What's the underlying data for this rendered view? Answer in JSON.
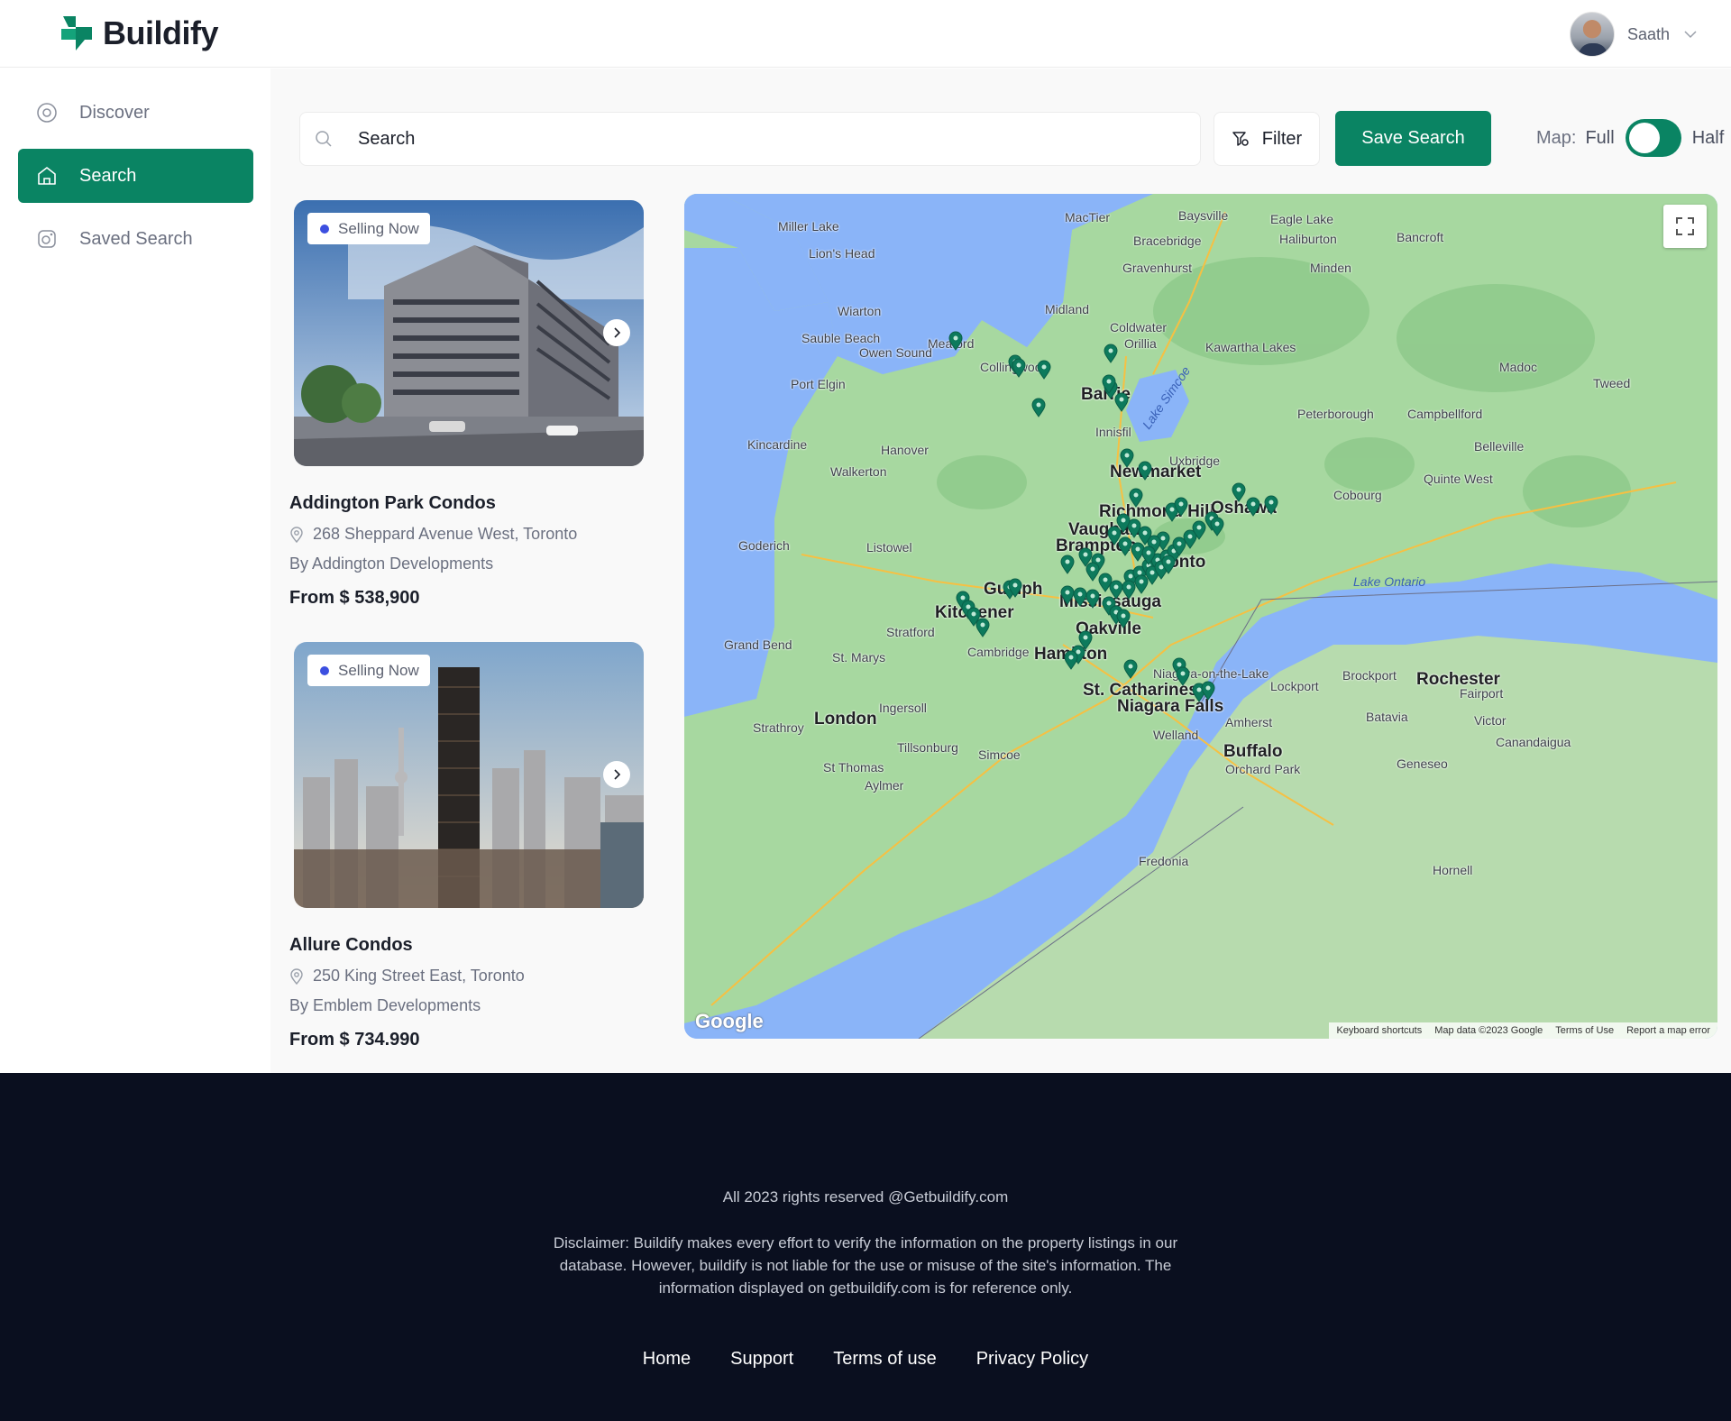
{
  "brand": {
    "name": "Buildify",
    "color": "#0a8463"
  },
  "user": {
    "name": "Saath"
  },
  "sidebar": {
    "items": [
      {
        "label": "Discover",
        "icon": "compass-icon",
        "active": false
      },
      {
        "label": "Search",
        "icon": "home-icon",
        "active": true
      },
      {
        "label": "Saved Search",
        "icon": "saved-search-icon",
        "active": false
      }
    ]
  },
  "toolbar": {
    "search_value": "Search",
    "filter_label": "Filter",
    "save_label": "Save Search",
    "map_label": "Map:",
    "map_full_label": "Full",
    "map_half_label": "Half"
  },
  "listings": [
    {
      "badge": "Selling Now",
      "title": "Addington Park Condos",
      "address": "268 Sheppard Avenue West, Toronto",
      "developer": "By Addington Developments",
      "price": "From $ 538,900"
    },
    {
      "badge": "Selling Now",
      "title": "Allure Condos",
      "address": "250 King Street East, Toronto",
      "developer": "By Emblem Developments",
      "price": "From $ 734.990"
    }
  ],
  "map": {
    "labels": [
      {
        "text": "Miller Lake"
      },
      {
        "text": "Lion's Head"
      },
      {
        "text": "Wiarton"
      },
      {
        "text": "Sauble Beach"
      },
      {
        "text": "Owen Sound"
      },
      {
        "text": "Meaford"
      },
      {
        "text": "Collingwood"
      },
      {
        "text": "Port Elgin"
      },
      {
        "text": "Kincardine"
      },
      {
        "text": "Hanover"
      },
      {
        "text": "Walkerton"
      },
      {
        "text": "Goderich"
      },
      {
        "text": "Listowel"
      },
      {
        "text": "Grand Bend"
      },
      {
        "text": "Stratford"
      },
      {
        "text": "St. Marys"
      },
      {
        "text": "London"
      },
      {
        "text": "Strathroy"
      },
      {
        "text": "Ingersoll"
      },
      {
        "text": "Tillsonburg"
      },
      {
        "text": "St Thomas"
      },
      {
        "text": "Aylmer"
      },
      {
        "text": "Simcoe"
      },
      {
        "text": "Cambridge"
      },
      {
        "text": "Kitchener"
      },
      {
        "text": "Guelph"
      },
      {
        "text": "Hamilton"
      },
      {
        "text": "Mississauga"
      },
      {
        "text": "Oakville"
      },
      {
        "text": "Brampton"
      },
      {
        "text": "Vaughan"
      },
      {
        "text": "Richmond Hill"
      },
      {
        "text": "Toronto"
      },
      {
        "text": "Newmarket"
      },
      {
        "text": "Uxbridge"
      },
      {
        "text": "Oshawa"
      },
      {
        "text": "Innisfil"
      },
      {
        "text": "Barrie"
      },
      {
        "text": "Orillia"
      },
      {
        "text": "Coldwater"
      },
      {
        "text": "Midland"
      },
      {
        "text": "MacTier"
      },
      {
        "text": "Baysville"
      },
      {
        "text": "Bracebridge"
      },
      {
        "text": "Gravenhurst"
      },
      {
        "text": "Eagle Lake"
      },
      {
        "text": "Haliburton"
      },
      {
        "text": "Minden"
      },
      {
        "text": "Bancroft"
      },
      {
        "text": "Kawartha Lakes"
      },
      {
        "text": "Madoc"
      },
      {
        "text": "Peterborough"
      },
      {
        "text": "Campbellford"
      },
      {
        "text": "Belleville"
      },
      {
        "text": "Quinte West"
      },
      {
        "text": "Cobourg"
      },
      {
        "text": "Tweed"
      },
      {
        "text": "St. Catharines"
      },
      {
        "text": "Niagara Falls"
      },
      {
        "text": "Niagara-on-the-Lake"
      },
      {
        "text": "Welland"
      },
      {
        "text": "Lockport"
      },
      {
        "text": "Brockport"
      },
      {
        "text": "Rochester"
      },
      {
        "text": "Fairport"
      },
      {
        "text": "Batavia"
      },
      {
        "text": "Victor"
      },
      {
        "text": "Canandaigua"
      },
      {
        "text": "Amherst"
      },
      {
        "text": "Buffalo"
      },
      {
        "text": "Orchard Park"
      },
      {
        "text": "Geneseo"
      },
      {
        "text": "Fredonia"
      },
      {
        "text": "Hornell"
      }
    ],
    "water_labels": [
      {
        "text": "Lake Ontario"
      },
      {
        "text": "Lake Simcoe"
      }
    ],
    "fullscreen_icon": "fullscreen-icon",
    "logo_text": "Google",
    "attribution": {
      "shortcuts": "Keyboard shortcuts",
      "data": "Map data ©2023 Google",
      "terms": "Terms of Use",
      "report": "Report a map error"
    }
  },
  "footer": {
    "copyright": "All 2023 rights reserved @Getbuildify.com",
    "disclaimer": "Disclaimer: Buildify makes every effort to verify the information on the property listings in our database. However, buildify is not liable for the use or misuse of the site's information. The information displayed on getbuildify.com is for reference only.",
    "links": [
      {
        "label": "Home"
      },
      {
        "label": "Support"
      },
      {
        "label": "Terms of use"
      },
      {
        "label": "Privacy Policy"
      }
    ]
  }
}
